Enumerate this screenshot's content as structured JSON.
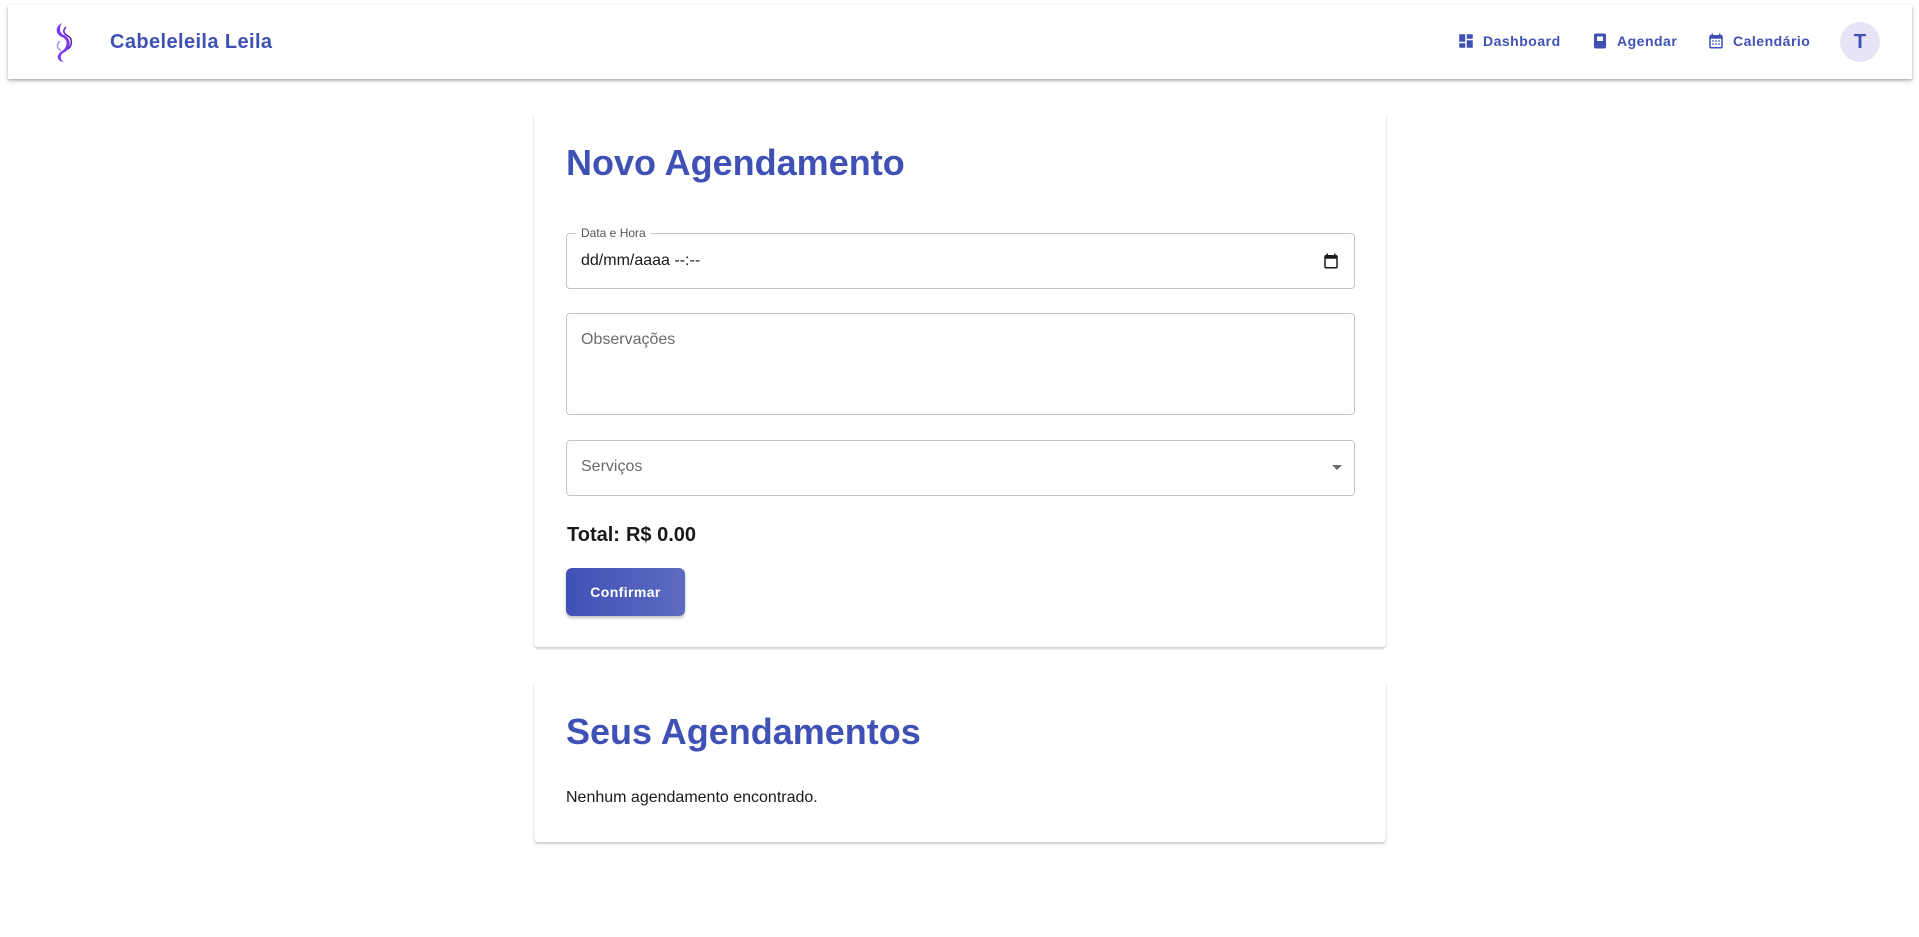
{
  "header": {
    "brand": "Cabeleleila Leila",
    "nav": [
      {
        "label": "Dashboard",
        "icon": "dashboard-icon"
      },
      {
        "label": "Agendar",
        "icon": "book-icon"
      },
      {
        "label": "Calendário",
        "icon": "calendar-icon"
      }
    ],
    "avatar_initial": "T"
  },
  "form": {
    "title": "Novo Agendamento",
    "datetime": {
      "label": "Data e Hora",
      "value": "dd/mm/aaaa --:--"
    },
    "observacoes": {
      "placeholder": "Observações"
    },
    "servicos": {
      "placeholder": "Serviços"
    },
    "total_label": "Total:",
    "total_value": "R$ 0.00",
    "confirm_label": "Confirmar"
  },
  "appointments": {
    "title": "Seus Agendamentos",
    "empty_message": "Nenhum agendamento encontrado."
  },
  "colors": {
    "primary": "#3f51b5",
    "avatar_bg": "#e8e4f6",
    "logo_purple": "#7c3aed"
  }
}
